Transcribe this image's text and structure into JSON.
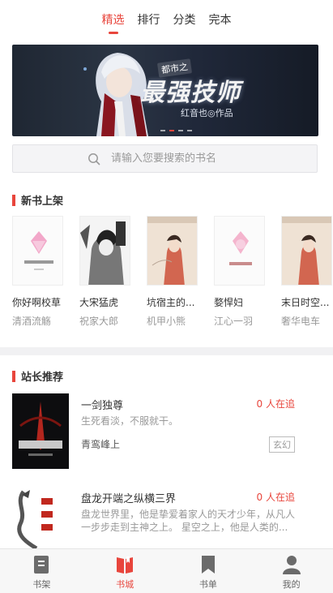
{
  "top_tabs": [
    {
      "label": "精选",
      "active": true
    },
    {
      "label": "排行",
      "active": false
    },
    {
      "label": "分类",
      "active": false
    },
    {
      "label": "完本",
      "active": false
    }
  ],
  "banner": {
    "title": "最强技师",
    "tag": "都市之",
    "author": "红音也◎作品"
  },
  "search": {
    "placeholder": "请输入您要搜索的书名",
    "icon": "search-icon"
  },
  "new_books": {
    "title": "新书上架",
    "books": [
      {
        "name": "你好啊校草",
        "author": "清酒流觞"
      },
      {
        "name": "大宋猛虎",
        "author": "祝家大郎"
      },
      {
        "name": "坑宿主的...",
        "author": "机甲小熊"
      },
      {
        "name": "婺悍妇",
        "author": "江心一羽"
      },
      {
        "name": "末日时空...",
        "author": "奢华电车"
      }
    ]
  },
  "recommend": {
    "title": "站长推荐",
    "items": [
      {
        "title": "一剑独尊",
        "readers": "0 人在追",
        "desc": "生死看淡，不服就干。",
        "author": "青鸾峰上",
        "tag": "玄幻"
      },
      {
        "title": "盘龙开端之纵横三界",
        "readers": "0 人在追",
        "desc": "盘龙世界里，他是挚爱着家人的天才少年，从凡人一步步走到主神之上。 星空之上，他是人类的...",
        "author": "",
        "tag": ""
      }
    ]
  },
  "tabbar": [
    {
      "label": "书架",
      "icon": "bookshelf-icon",
      "active": false
    },
    {
      "label": "书城",
      "icon": "bookstore-icon",
      "active": true
    },
    {
      "label": "书单",
      "icon": "booklist-icon",
      "active": false
    },
    {
      "label": "我的",
      "icon": "user-icon",
      "active": false
    }
  ],
  "colors": {
    "accent": "#e8453c"
  }
}
